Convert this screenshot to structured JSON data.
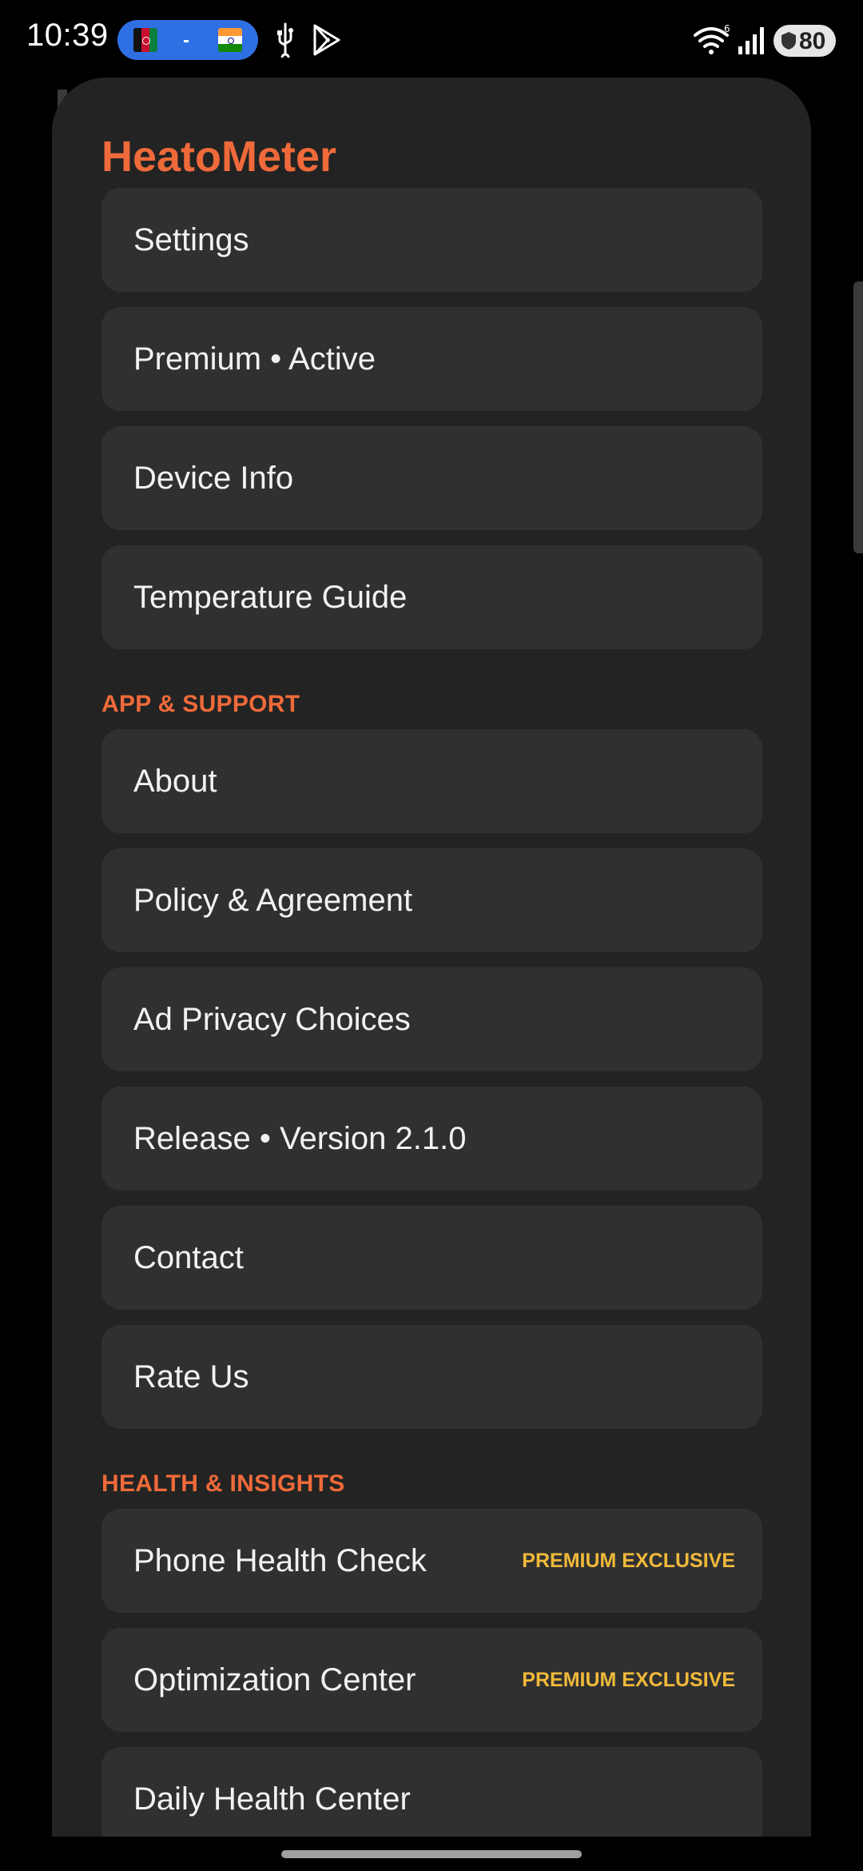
{
  "status_bar": {
    "time": "10:39",
    "battery": "80",
    "wifi_badge": "6"
  },
  "drawer": {
    "title": "HeatoMeter",
    "main_items": [
      {
        "label": "Settings"
      },
      {
        "label": "Premium • Active"
      },
      {
        "label": "Device Info"
      },
      {
        "label": "Temperature Guide"
      }
    ],
    "app_support": {
      "header": "APP & SUPPORT",
      "items": [
        {
          "label": "About"
        },
        {
          "label": "Policy & Agreement"
        },
        {
          "label": "Ad Privacy Choices"
        },
        {
          "label": "Release • Version 2.1.0"
        },
        {
          "label": "Contact"
        },
        {
          "label": "Rate Us"
        }
      ]
    },
    "health_insights": {
      "header": "HEALTH & INSIGHTS",
      "items": [
        {
          "label": "Phone Health Check",
          "badge": "PREMIUM EXCLUSIVE"
        },
        {
          "label": "Optimization Center",
          "badge": "PREMIUM EXCLUSIVE"
        },
        {
          "label": "Daily Health Center"
        }
      ]
    }
  },
  "colors": {
    "accent": "#ef6a3a",
    "badge": "#f0b93a",
    "drawer_bg": "#232323",
    "item_bg": "#303030"
  },
  "icons": [
    "usb-icon",
    "play-store-icon",
    "wifi-icon",
    "signal-icon",
    "battery-icon",
    "shield-icon"
  ]
}
